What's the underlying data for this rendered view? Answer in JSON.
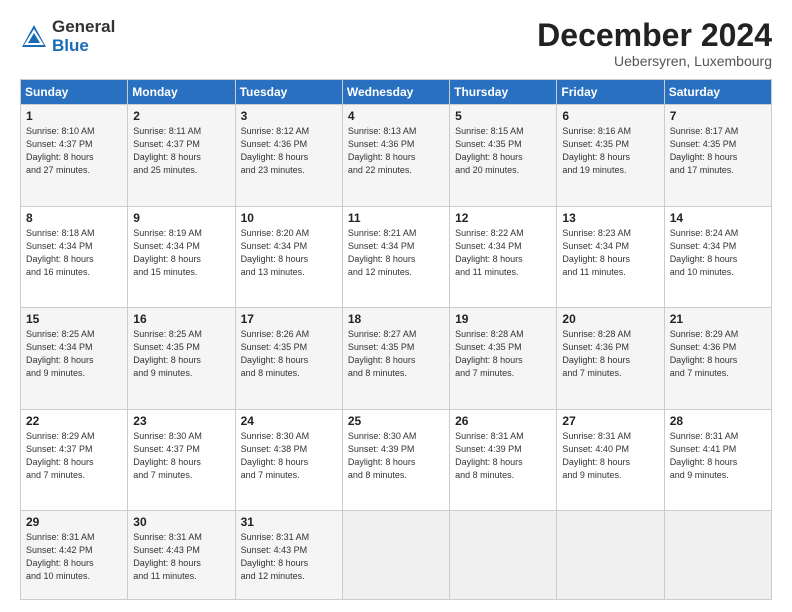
{
  "header": {
    "logo_general": "General",
    "logo_blue": "Blue",
    "month_title": "December 2024",
    "subtitle": "Uebersyren, Luxembourg"
  },
  "days_of_week": [
    "Sunday",
    "Monday",
    "Tuesday",
    "Wednesday",
    "Thursday",
    "Friday",
    "Saturday"
  ],
  "weeks": [
    [
      {
        "day": "1",
        "info": "Sunrise: 8:10 AM\nSunset: 4:37 PM\nDaylight: 8 hours\nand 27 minutes."
      },
      {
        "day": "2",
        "info": "Sunrise: 8:11 AM\nSunset: 4:37 PM\nDaylight: 8 hours\nand 25 minutes."
      },
      {
        "day": "3",
        "info": "Sunrise: 8:12 AM\nSunset: 4:36 PM\nDaylight: 8 hours\nand 23 minutes."
      },
      {
        "day": "4",
        "info": "Sunrise: 8:13 AM\nSunset: 4:36 PM\nDaylight: 8 hours\nand 22 minutes."
      },
      {
        "day": "5",
        "info": "Sunrise: 8:15 AM\nSunset: 4:35 PM\nDaylight: 8 hours\nand 20 minutes."
      },
      {
        "day": "6",
        "info": "Sunrise: 8:16 AM\nSunset: 4:35 PM\nDaylight: 8 hours\nand 19 minutes."
      },
      {
        "day": "7",
        "info": "Sunrise: 8:17 AM\nSunset: 4:35 PM\nDaylight: 8 hours\nand 17 minutes."
      }
    ],
    [
      {
        "day": "8",
        "info": "Sunrise: 8:18 AM\nSunset: 4:34 PM\nDaylight: 8 hours\nand 16 minutes."
      },
      {
        "day": "9",
        "info": "Sunrise: 8:19 AM\nSunset: 4:34 PM\nDaylight: 8 hours\nand 15 minutes."
      },
      {
        "day": "10",
        "info": "Sunrise: 8:20 AM\nSunset: 4:34 PM\nDaylight: 8 hours\nand 13 minutes."
      },
      {
        "day": "11",
        "info": "Sunrise: 8:21 AM\nSunset: 4:34 PM\nDaylight: 8 hours\nand 12 minutes."
      },
      {
        "day": "12",
        "info": "Sunrise: 8:22 AM\nSunset: 4:34 PM\nDaylight: 8 hours\nand 11 minutes."
      },
      {
        "day": "13",
        "info": "Sunrise: 8:23 AM\nSunset: 4:34 PM\nDaylight: 8 hours\nand 11 minutes."
      },
      {
        "day": "14",
        "info": "Sunrise: 8:24 AM\nSunset: 4:34 PM\nDaylight: 8 hours\nand 10 minutes."
      }
    ],
    [
      {
        "day": "15",
        "info": "Sunrise: 8:25 AM\nSunset: 4:34 PM\nDaylight: 8 hours\nand 9 minutes."
      },
      {
        "day": "16",
        "info": "Sunrise: 8:25 AM\nSunset: 4:35 PM\nDaylight: 8 hours\nand 9 minutes."
      },
      {
        "day": "17",
        "info": "Sunrise: 8:26 AM\nSunset: 4:35 PM\nDaylight: 8 hours\nand 8 minutes."
      },
      {
        "day": "18",
        "info": "Sunrise: 8:27 AM\nSunset: 4:35 PM\nDaylight: 8 hours\nand 8 minutes."
      },
      {
        "day": "19",
        "info": "Sunrise: 8:28 AM\nSunset: 4:35 PM\nDaylight: 8 hours\nand 7 minutes."
      },
      {
        "day": "20",
        "info": "Sunrise: 8:28 AM\nSunset: 4:36 PM\nDaylight: 8 hours\nand 7 minutes."
      },
      {
        "day": "21",
        "info": "Sunrise: 8:29 AM\nSunset: 4:36 PM\nDaylight: 8 hours\nand 7 minutes."
      }
    ],
    [
      {
        "day": "22",
        "info": "Sunrise: 8:29 AM\nSunset: 4:37 PM\nDaylight: 8 hours\nand 7 minutes."
      },
      {
        "day": "23",
        "info": "Sunrise: 8:30 AM\nSunset: 4:37 PM\nDaylight: 8 hours\nand 7 minutes."
      },
      {
        "day": "24",
        "info": "Sunrise: 8:30 AM\nSunset: 4:38 PM\nDaylight: 8 hours\nand 7 minutes."
      },
      {
        "day": "25",
        "info": "Sunrise: 8:30 AM\nSunset: 4:39 PM\nDaylight: 8 hours\nand 8 minutes."
      },
      {
        "day": "26",
        "info": "Sunrise: 8:31 AM\nSunset: 4:39 PM\nDaylight: 8 hours\nand 8 minutes."
      },
      {
        "day": "27",
        "info": "Sunrise: 8:31 AM\nSunset: 4:40 PM\nDaylight: 8 hours\nand 9 minutes."
      },
      {
        "day": "28",
        "info": "Sunrise: 8:31 AM\nSunset: 4:41 PM\nDaylight: 8 hours\nand 9 minutes."
      }
    ],
    [
      {
        "day": "29",
        "info": "Sunrise: 8:31 AM\nSunset: 4:42 PM\nDaylight: 8 hours\nand 10 minutes."
      },
      {
        "day": "30",
        "info": "Sunrise: 8:31 AM\nSunset: 4:43 PM\nDaylight: 8 hours\nand 11 minutes."
      },
      {
        "day": "31",
        "info": "Sunrise: 8:31 AM\nSunset: 4:43 PM\nDaylight: 8 hours\nand 12 minutes."
      },
      {
        "day": "",
        "info": ""
      },
      {
        "day": "",
        "info": ""
      },
      {
        "day": "",
        "info": ""
      },
      {
        "day": "",
        "info": ""
      }
    ]
  ]
}
